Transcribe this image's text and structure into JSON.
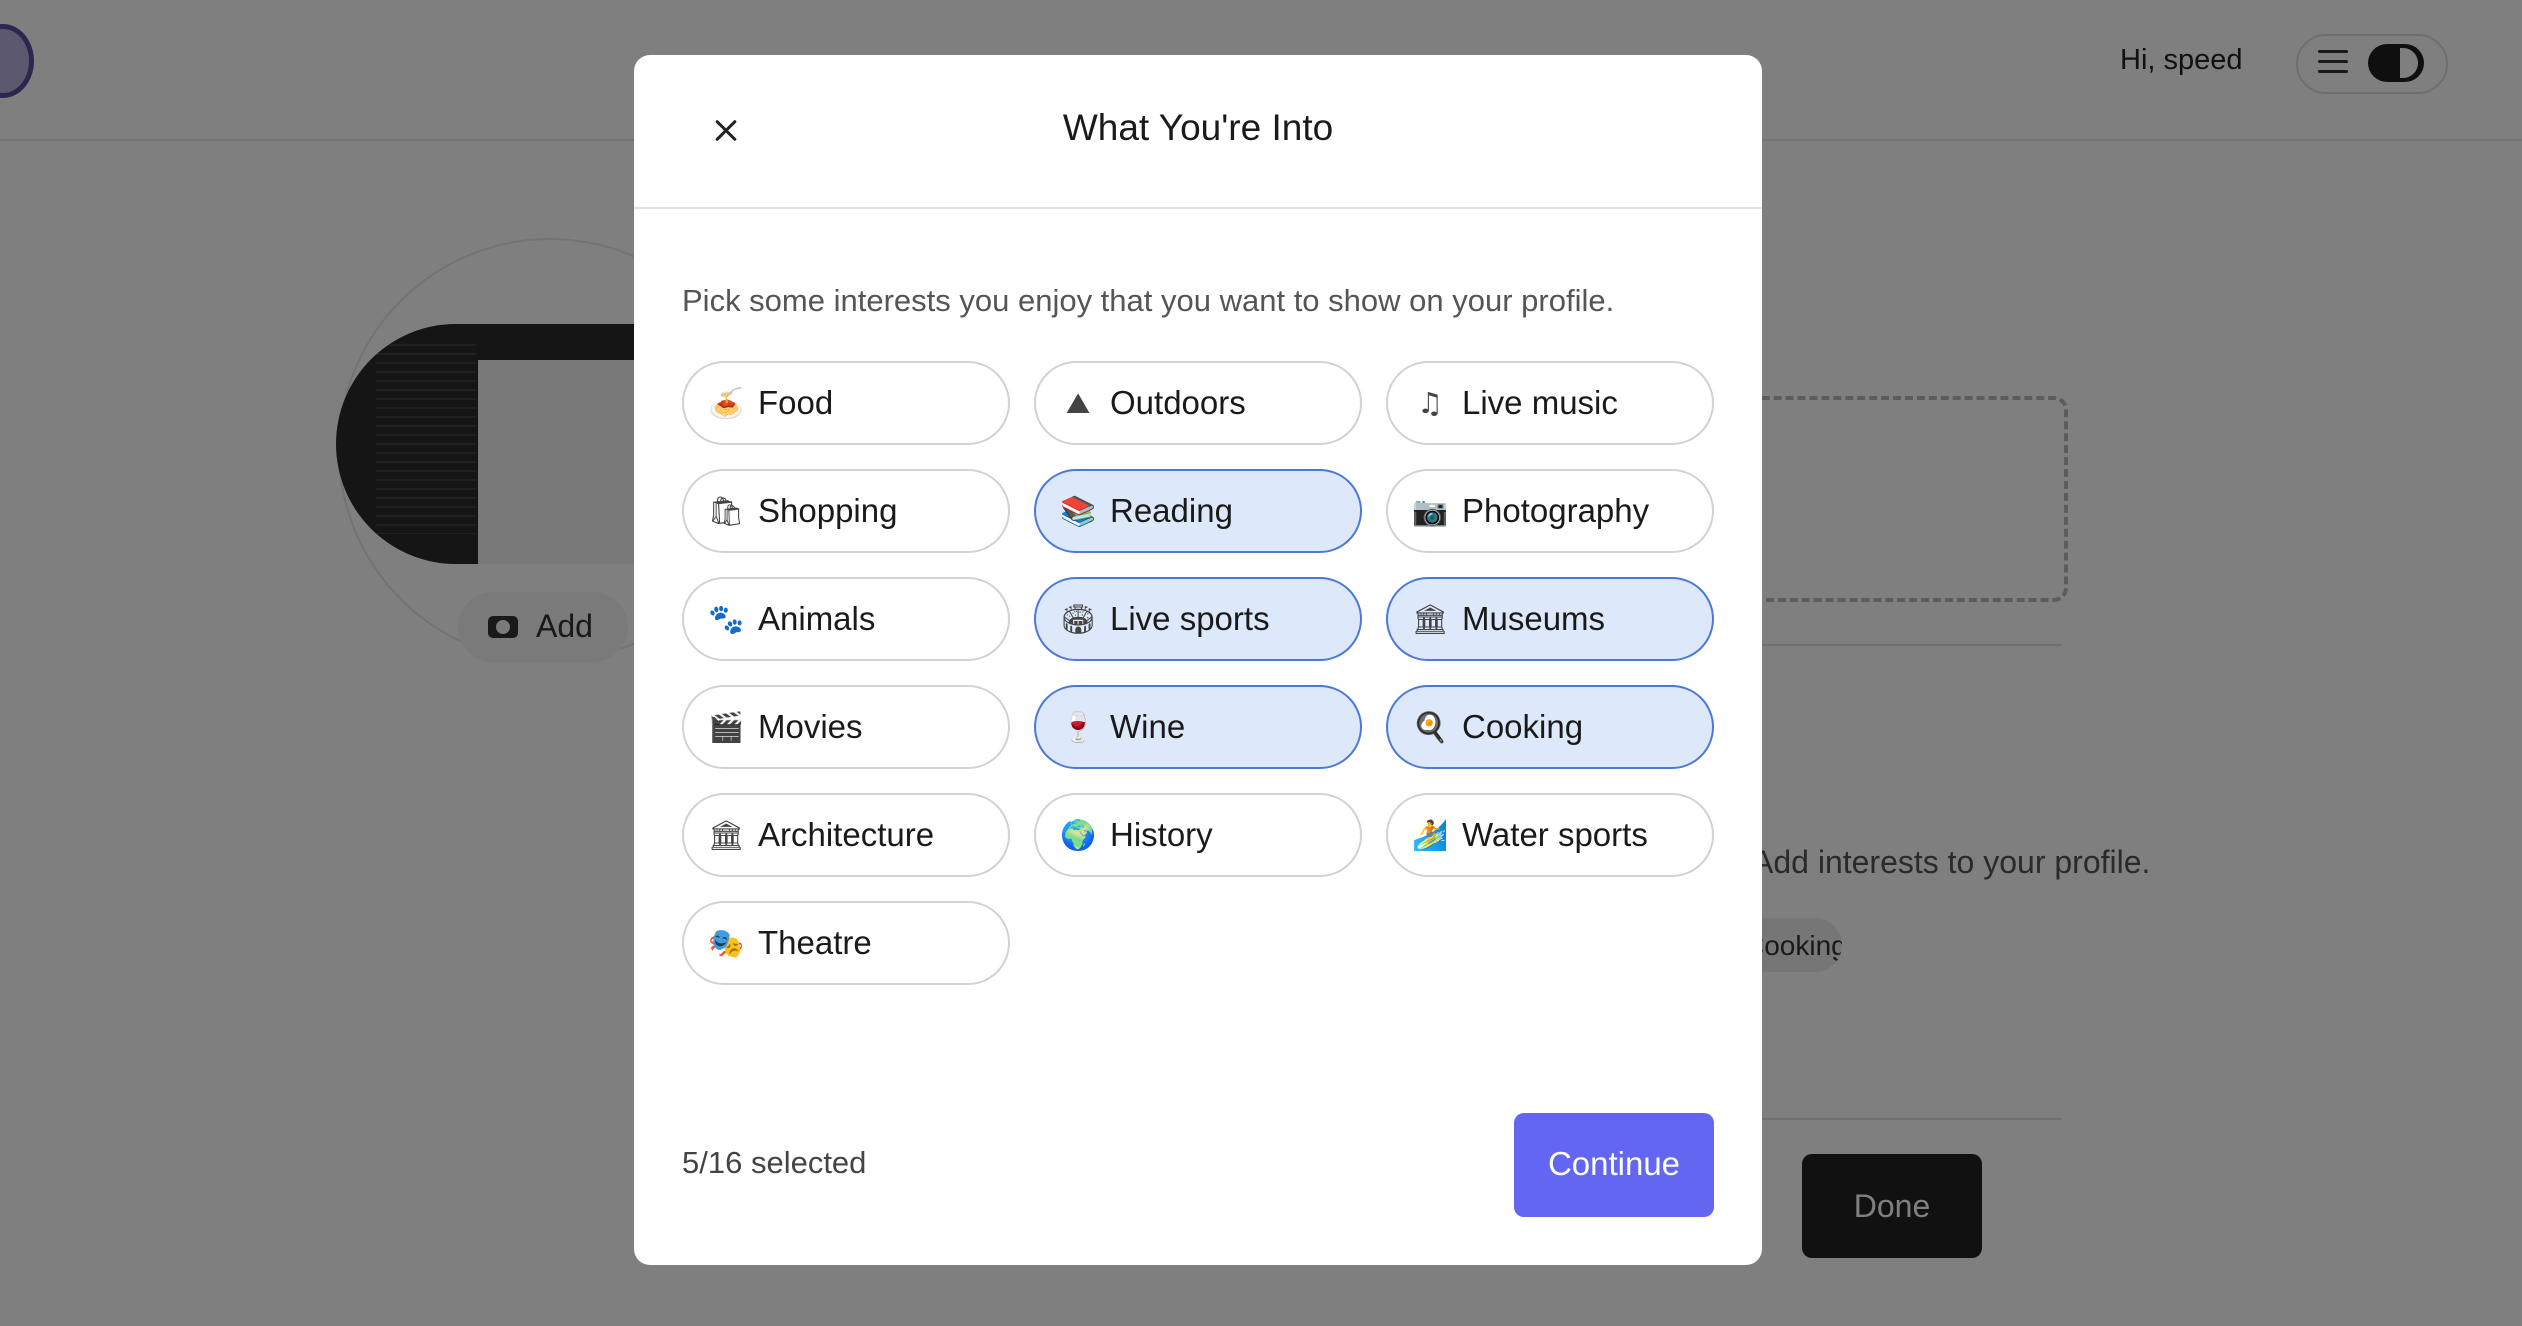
{
  "header": {
    "greeting": "Hi, speed"
  },
  "profile": {
    "add_photo_label": "Add",
    "interests_hint": "Add interests to your profile.",
    "interest_chip_label": "Cooking",
    "done_label": "Done"
  },
  "modal": {
    "title": "What You're Into",
    "description": "Pick some interests you enjoy that you want to show on your profile.",
    "selected_count": "5/16 selected",
    "continue_label": "Continue",
    "interests": [
      {
        "label": "Food",
        "icon": "🍝",
        "icon_name": "spaghetti-icon",
        "selected": false
      },
      {
        "label": "Outdoors",
        "icon": "⛰",
        "icon_name": "landscape-icon",
        "selected": false
      },
      {
        "label": "Live music",
        "icon": "♫",
        "icon_name": "music-notes-icon",
        "selected": false
      },
      {
        "label": "Shopping",
        "icon": "🛍",
        "icon_name": "shopping-bags-icon",
        "selected": false
      },
      {
        "label": "Reading",
        "icon": "📚",
        "icon_name": "books-icon",
        "selected": true
      },
      {
        "label": "Photography",
        "icon": "📷",
        "icon_name": "camera-icon",
        "selected": false
      },
      {
        "label": "Animals",
        "icon": "🐾",
        "icon_name": "paw-prints-icon",
        "selected": false
      },
      {
        "label": "Live sports",
        "icon": "🏟",
        "icon_name": "stadium-icon",
        "selected": true
      },
      {
        "label": "Museums",
        "icon": "🏛",
        "icon_name": "classical-building-icon",
        "selected": true
      },
      {
        "label": "Movies",
        "icon": "🎬",
        "icon_name": "clapper-board-icon",
        "selected": false
      },
      {
        "label": "Wine",
        "icon": "🍷",
        "icon_name": "wine-glass-icon",
        "selected": true
      },
      {
        "label": "Cooking",
        "icon": "🍳",
        "icon_name": "frying-pan-icon",
        "selected": true
      },
      {
        "label": "Architecture",
        "icon": "🏛",
        "icon_name": "classical-building-icon",
        "selected": false
      },
      {
        "label": "History",
        "icon": "🌍",
        "icon_name": "globe-icon",
        "selected": false
      },
      {
        "label": "Water sports",
        "icon": "🏄",
        "icon_name": "surfer-icon",
        "selected": false
      },
      {
        "label": "Theatre",
        "icon": "🎭",
        "icon_name": "theatre-masks-icon",
        "selected": false
      }
    ]
  },
  "colors": {
    "accent": "#6366f1",
    "selected_chip_bg": "#dde8fb",
    "selected_chip_border": "#4d79d6",
    "overlay": "rgba(0,0,0,0.5)"
  }
}
